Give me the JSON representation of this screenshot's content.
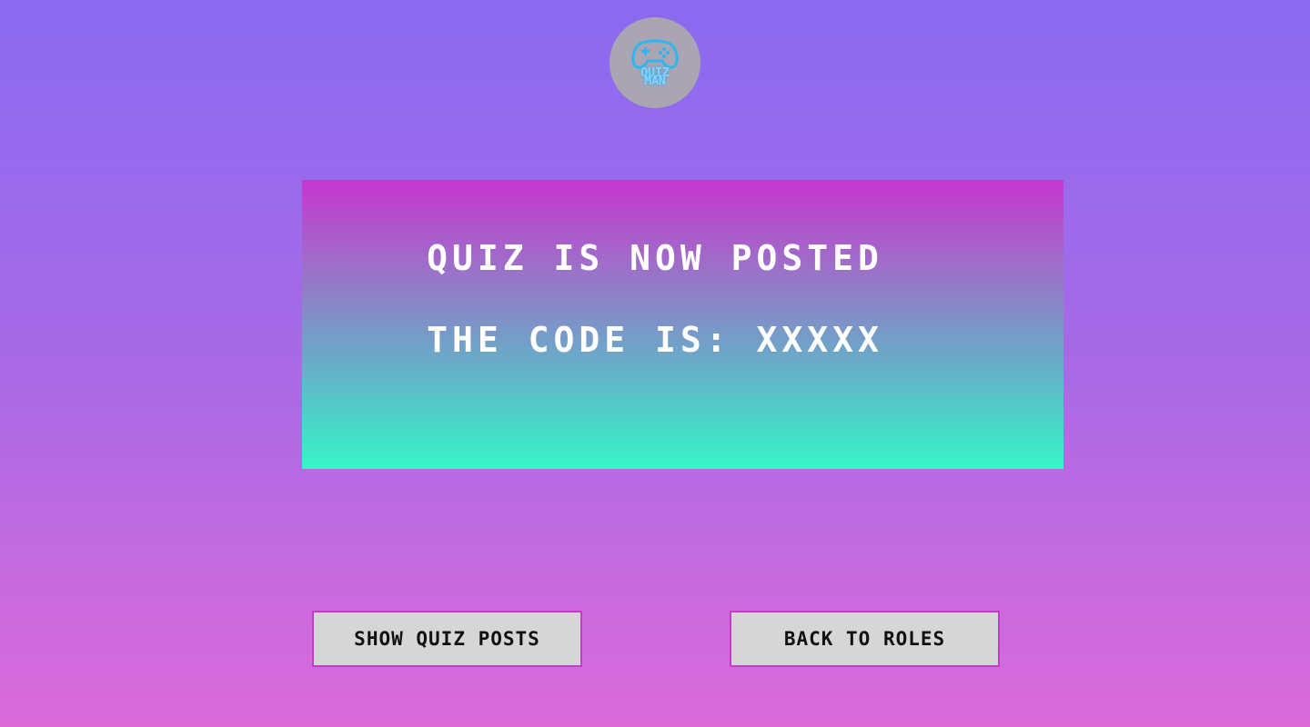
{
  "logo": {
    "icon": "gamepad-icon",
    "line1": "QUIZ",
    "line2": "MAN",
    "color": "#7fd9ff"
  },
  "banner": {
    "line1": "QUIZ IS NOW POSTED",
    "line2": "THE CODE IS: XXXXX"
  },
  "buttons": {
    "show_quiz_posts": "SHOW QUIZ POSTS",
    "back_to_roles": "BACK TO ROLES"
  },
  "colors": {
    "button_border": "#c23ec6",
    "button_bg": "#d6d6d6",
    "banner_top": "#c636d0",
    "banner_bottom": "#36f6c8"
  }
}
